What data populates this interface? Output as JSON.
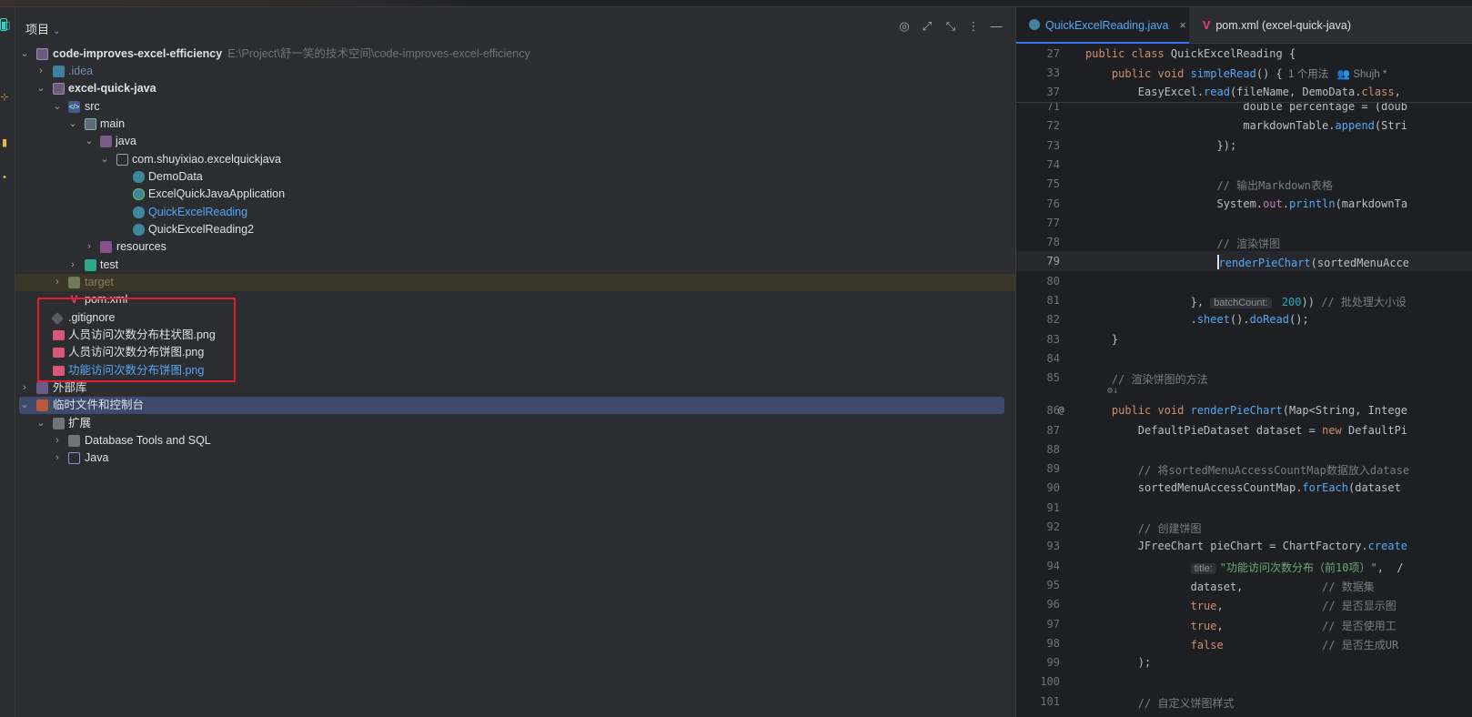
{
  "toolstrip": {
    "icons": [
      "project-icon",
      "commit-icon",
      "structure-icon",
      "bookmarks-icon"
    ]
  },
  "project": {
    "title": "项目",
    "header_icons": [
      "target-icon",
      "expand-icon",
      "collapse-icon",
      "more-icon",
      "minimize-icon"
    ],
    "tree": [
      {
        "label": "code-improves-excel-efficiency",
        "extra": "E:\\Project\\舒一笑的技术空间\\code-improves-excel-efficiency",
        "icon": "module-folder-icon"
      },
      {
        "label": ".idea",
        "icon": "folder-icon"
      },
      {
        "label": "excel-quick-java",
        "icon": "module-folder-icon"
      },
      {
        "label": "src",
        "icon": "source-folder-icon"
      },
      {
        "label": "main",
        "icon": "folder-icon"
      },
      {
        "label": "java",
        "icon": "java-source-folder-icon"
      },
      {
        "label": "com.shuyixiao.excelquickjava",
        "icon": "package-icon"
      },
      {
        "label": "DemoData",
        "icon": "class-icon"
      },
      {
        "label": "ExcelQuickJavaApplication",
        "icon": "spring-class-icon"
      },
      {
        "label": "QuickExcelReading",
        "icon": "class-icon"
      },
      {
        "label": "QuickExcelReading2",
        "icon": "class-icon"
      },
      {
        "label": "resources",
        "icon": "resources-folder-icon"
      },
      {
        "label": "test",
        "icon": "test-folder-icon"
      },
      {
        "label": "target",
        "icon": "excluded-folder-icon"
      },
      {
        "label": "pom.xml",
        "icon": "maven-icon"
      },
      {
        "label": ".gitignore",
        "icon": "gitignore-icon"
      },
      {
        "label": "人员访问次数分布柱状图.png",
        "icon": "image-icon"
      },
      {
        "label": "人员访问次数分布饼图.png",
        "icon": "image-icon"
      },
      {
        "label": "功能访问次数分布饼图.png",
        "icon": "image-icon"
      },
      {
        "label": "外部库",
        "icon": "library-icon"
      },
      {
        "label": "临时文件和控制台",
        "icon": "scratches-icon"
      },
      {
        "label": "扩展",
        "icon": "folder-icon"
      },
      {
        "label": "Database Tools and SQL",
        "icon": "folder-icon"
      },
      {
        "label": "Java",
        "icon": "java-ext-icon"
      }
    ]
  },
  "editor": {
    "tabs": [
      {
        "label": "QuickExcelReading.java",
        "close": "×",
        "icon": "class-icon"
      },
      {
        "label": "pom.xml (excel-quick-java)",
        "icon": "maven-icon"
      }
    ],
    "sticky": [
      {
        "n": "27",
        "parts": [
          [
            "kw",
            "public class "
          ],
          [
            "cls",
            "QuickExcelReading {"
          ]
        ]
      },
      {
        "n": "33",
        "parts": [
          [
            "kw",
            "    public void "
          ],
          [
            "fn",
            "simpleRead"
          ],
          [
            "cls",
            "() {"
          ]
        ],
        "inlay": "  1 个用法   👥 Shujh *"
      },
      {
        "n": "37",
        "parts": [
          [
            "cls",
            "        EasyExcel."
          ],
          [
            "fn",
            "read"
          ],
          [
            "cls",
            "(fileName, DemoData."
          ],
          [
            "kw",
            "class"
          ],
          [
            "cls",
            ", "
          ]
        ]
      }
    ],
    "lines": [
      {
        "n": "71",
        "parts": [
          [
            "cls",
            "                        double percentage = (doub"
          ]
        ]
      },
      {
        "n": "72",
        "parts": [
          [
            "cls",
            "                        markdownTable."
          ],
          [
            "fn",
            "append"
          ],
          [
            "cls",
            "(Stri"
          ]
        ]
      },
      {
        "n": "73",
        "parts": [
          [
            "cls",
            "                    });"
          ]
        ]
      },
      {
        "n": "74",
        "parts": []
      },
      {
        "n": "75",
        "parts": [
          [
            "cm",
            "                    // 输出Markdown表格"
          ]
        ]
      },
      {
        "n": "76",
        "parts": [
          [
            "cls",
            "                    System."
          ],
          [
            "fld",
            "out"
          ],
          [
            "cls",
            "."
          ],
          [
            "fn",
            "println"
          ],
          [
            "cls",
            "(markdownTa"
          ]
        ]
      },
      {
        "n": "77",
        "parts": []
      },
      {
        "n": "78",
        "parts": [
          [
            "cm",
            "                    // 渲染饼图"
          ]
        ]
      },
      {
        "n": "79",
        "parts": [
          [
            "cls",
            "                    "
          ],
          [
            "fn",
            "renderPieChart"
          ],
          [
            "cls",
            "(sortedMenuAcce"
          ]
        ],
        "current": true
      },
      {
        "n": "80",
        "parts": []
      },
      {
        "n": "81",
        "parts": [
          [
            "cls",
            "                }, "
          ],
          [
            "hint",
            "batchCount:"
          ],
          [
            "num",
            " 200"
          ],
          [
            "cls",
            ")) "
          ],
          [
            "cm",
            "// 批处理大小设"
          ]
        ]
      },
      {
        "n": "82",
        "parts": [
          [
            "cls",
            "                ."
          ],
          [
            "fn",
            "sheet"
          ],
          [
            "cls",
            "()."
          ],
          [
            "fn",
            "doRead"
          ],
          [
            "cls",
            "();"
          ]
        ]
      },
      {
        "n": "83",
        "parts": [
          [
            "cls",
            "    }"
          ]
        ]
      },
      {
        "n": "84",
        "parts": []
      },
      {
        "n": "85",
        "parts": [
          [
            "cm",
            "    // 渲染饼图的方法"
          ]
        ],
        "after": "    ⚙↓"
      },
      {
        "n": "86",
        "parts": [
          [
            "kw",
            "    public void "
          ],
          [
            "fn",
            "renderPieChart"
          ],
          [
            "cls",
            "(Map<String, Intege"
          ]
        ],
        "at": "@"
      },
      {
        "n": "87",
        "parts": [
          [
            "cls",
            "        DefaultPieDataset dataset = "
          ],
          [
            "kw",
            "new "
          ],
          [
            "cls",
            "DefaultPi"
          ]
        ]
      },
      {
        "n": "88",
        "parts": []
      },
      {
        "n": "89",
        "parts": [
          [
            "cm",
            "        // 将sortedMenuAccessCountMap数据放入datase"
          ]
        ]
      },
      {
        "n": "90",
        "parts": [
          [
            "cls",
            "        sortedMenuAccessCountMap."
          ],
          [
            "fn",
            "forEach"
          ],
          [
            "cls",
            "(dataset"
          ]
        ]
      },
      {
        "n": "91",
        "parts": []
      },
      {
        "n": "92",
        "parts": [
          [
            "cm",
            "        // 创建饼图"
          ]
        ]
      },
      {
        "n": "93",
        "parts": [
          [
            "cls",
            "        JFreeChart pieChart = ChartFactory."
          ],
          [
            "fn",
            "create"
          ]
        ]
      },
      {
        "n": "94",
        "parts": [
          [
            "cls",
            "                "
          ],
          [
            "hint",
            "title:"
          ],
          [
            "str",
            "\"功能访问次数分布（前10项）\""
          ],
          [
            "cls",
            ",  /"
          ]
        ]
      },
      {
        "n": "95",
        "parts": [
          [
            "cls",
            "                dataset,            "
          ],
          [
            "cm",
            "// 数据集"
          ]
        ]
      },
      {
        "n": "96",
        "parts": [
          [
            "kw",
            "                true"
          ],
          [
            "cls",
            ",               "
          ],
          [
            "cm",
            "// 是否显示图"
          ]
        ]
      },
      {
        "n": "97",
        "parts": [
          [
            "kw",
            "                true"
          ],
          [
            "cls",
            ",               "
          ],
          [
            "cm",
            "// 是否使用工"
          ]
        ]
      },
      {
        "n": "98",
        "parts": [
          [
            "kw",
            "                false"
          ],
          [
            "cls",
            "               "
          ],
          [
            "cm",
            "// 是否生成UR"
          ]
        ]
      },
      {
        "n": "99",
        "parts": [
          [
            "cls",
            "        );"
          ]
        ]
      },
      {
        "n": "100",
        "parts": []
      },
      {
        "n": "101",
        "parts": [
          [
            "cm",
            "        // 自定义饼图样式"
          ]
        ]
      }
    ]
  }
}
